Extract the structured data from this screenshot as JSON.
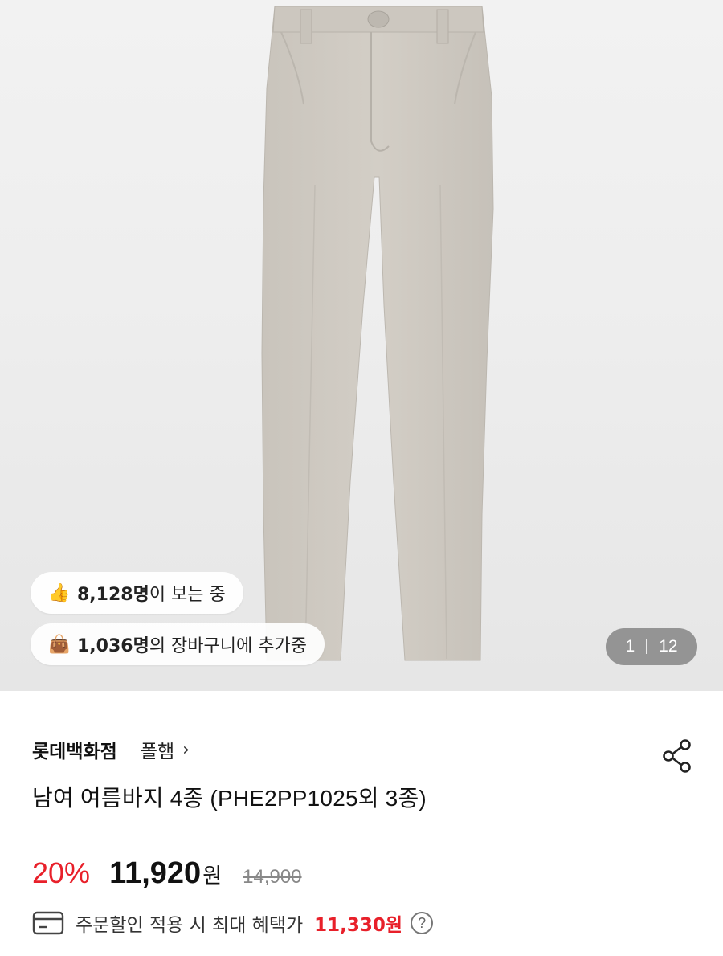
{
  "hero": {
    "image_alt": "beige pants",
    "viewers": {
      "icon": "thumbs-up-icon",
      "count": "8,128명",
      "suffix": "이 보는 중"
    },
    "cart": {
      "icon": "shopping-bag-icon",
      "count": "1,036명",
      "suffix": "의 장바구니에 추가중"
    },
    "counter": {
      "current": "1",
      "total": "12"
    }
  },
  "store": {
    "name": "롯데백화점",
    "brand": "폴햄",
    "chevron": "›"
  },
  "share_icon": "share-icon",
  "product": {
    "title": "남여 여름바지 4종 (PHE2PP1025외 3종)"
  },
  "price": {
    "discount": "20%",
    "amount": "11,920",
    "unit": "원",
    "original": "14,900"
  },
  "benefit": {
    "icon": "card-icon",
    "text": "주문할인 적용 시 최대 혜택가",
    "amount": "11,330원",
    "help": "?"
  },
  "colors": {
    "accent": "#e8202a",
    "pants": "#cfcac2"
  }
}
